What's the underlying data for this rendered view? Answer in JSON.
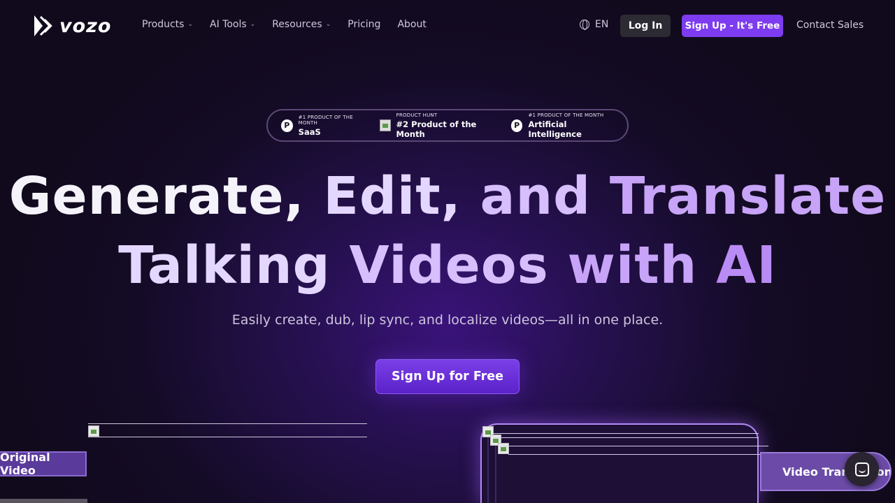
{
  "nav": {
    "brand": "vozo",
    "items": [
      {
        "label": "Products",
        "has_dropdown": true
      },
      {
        "label": "AI Tools",
        "has_dropdown": true
      },
      {
        "label": "Resources",
        "has_dropdown": true
      },
      {
        "label": "Pricing",
        "has_dropdown": false
      },
      {
        "label": "About",
        "has_dropdown": false
      }
    ],
    "language": "EN",
    "login_label": "Log In",
    "signup_label": "Sign Up - It's Free",
    "contact_label": "Contact Sales"
  },
  "awards": [
    {
      "small": "#1 PRODUCT OF THE MONTH",
      "big": "SaaS",
      "icon": "producthunt-icon"
    },
    {
      "small": "PRODUCT HUNT",
      "big": "#2 Product of the Month",
      "icon": "broken-image-icon"
    },
    {
      "small": "#1 PRODUCT OF THE MONTH",
      "big": "Artificial Intelligence",
      "icon": "producthunt-icon"
    }
  ],
  "hero": {
    "line1": [
      "Generate,",
      "Edit,",
      "and",
      "Translate"
    ],
    "line2": [
      "Talking",
      "Videos",
      "with",
      "AI"
    ],
    "subtitle": "Easily create, dub, lip sync, and localize videos—all in one place.",
    "cta_label": "Sign Up for Free"
  },
  "video": {
    "original_label": "Original Video",
    "translated_label": "Video Translation"
  },
  "colors": {
    "accent": "#7d3cf0",
    "background": "#140b26"
  }
}
